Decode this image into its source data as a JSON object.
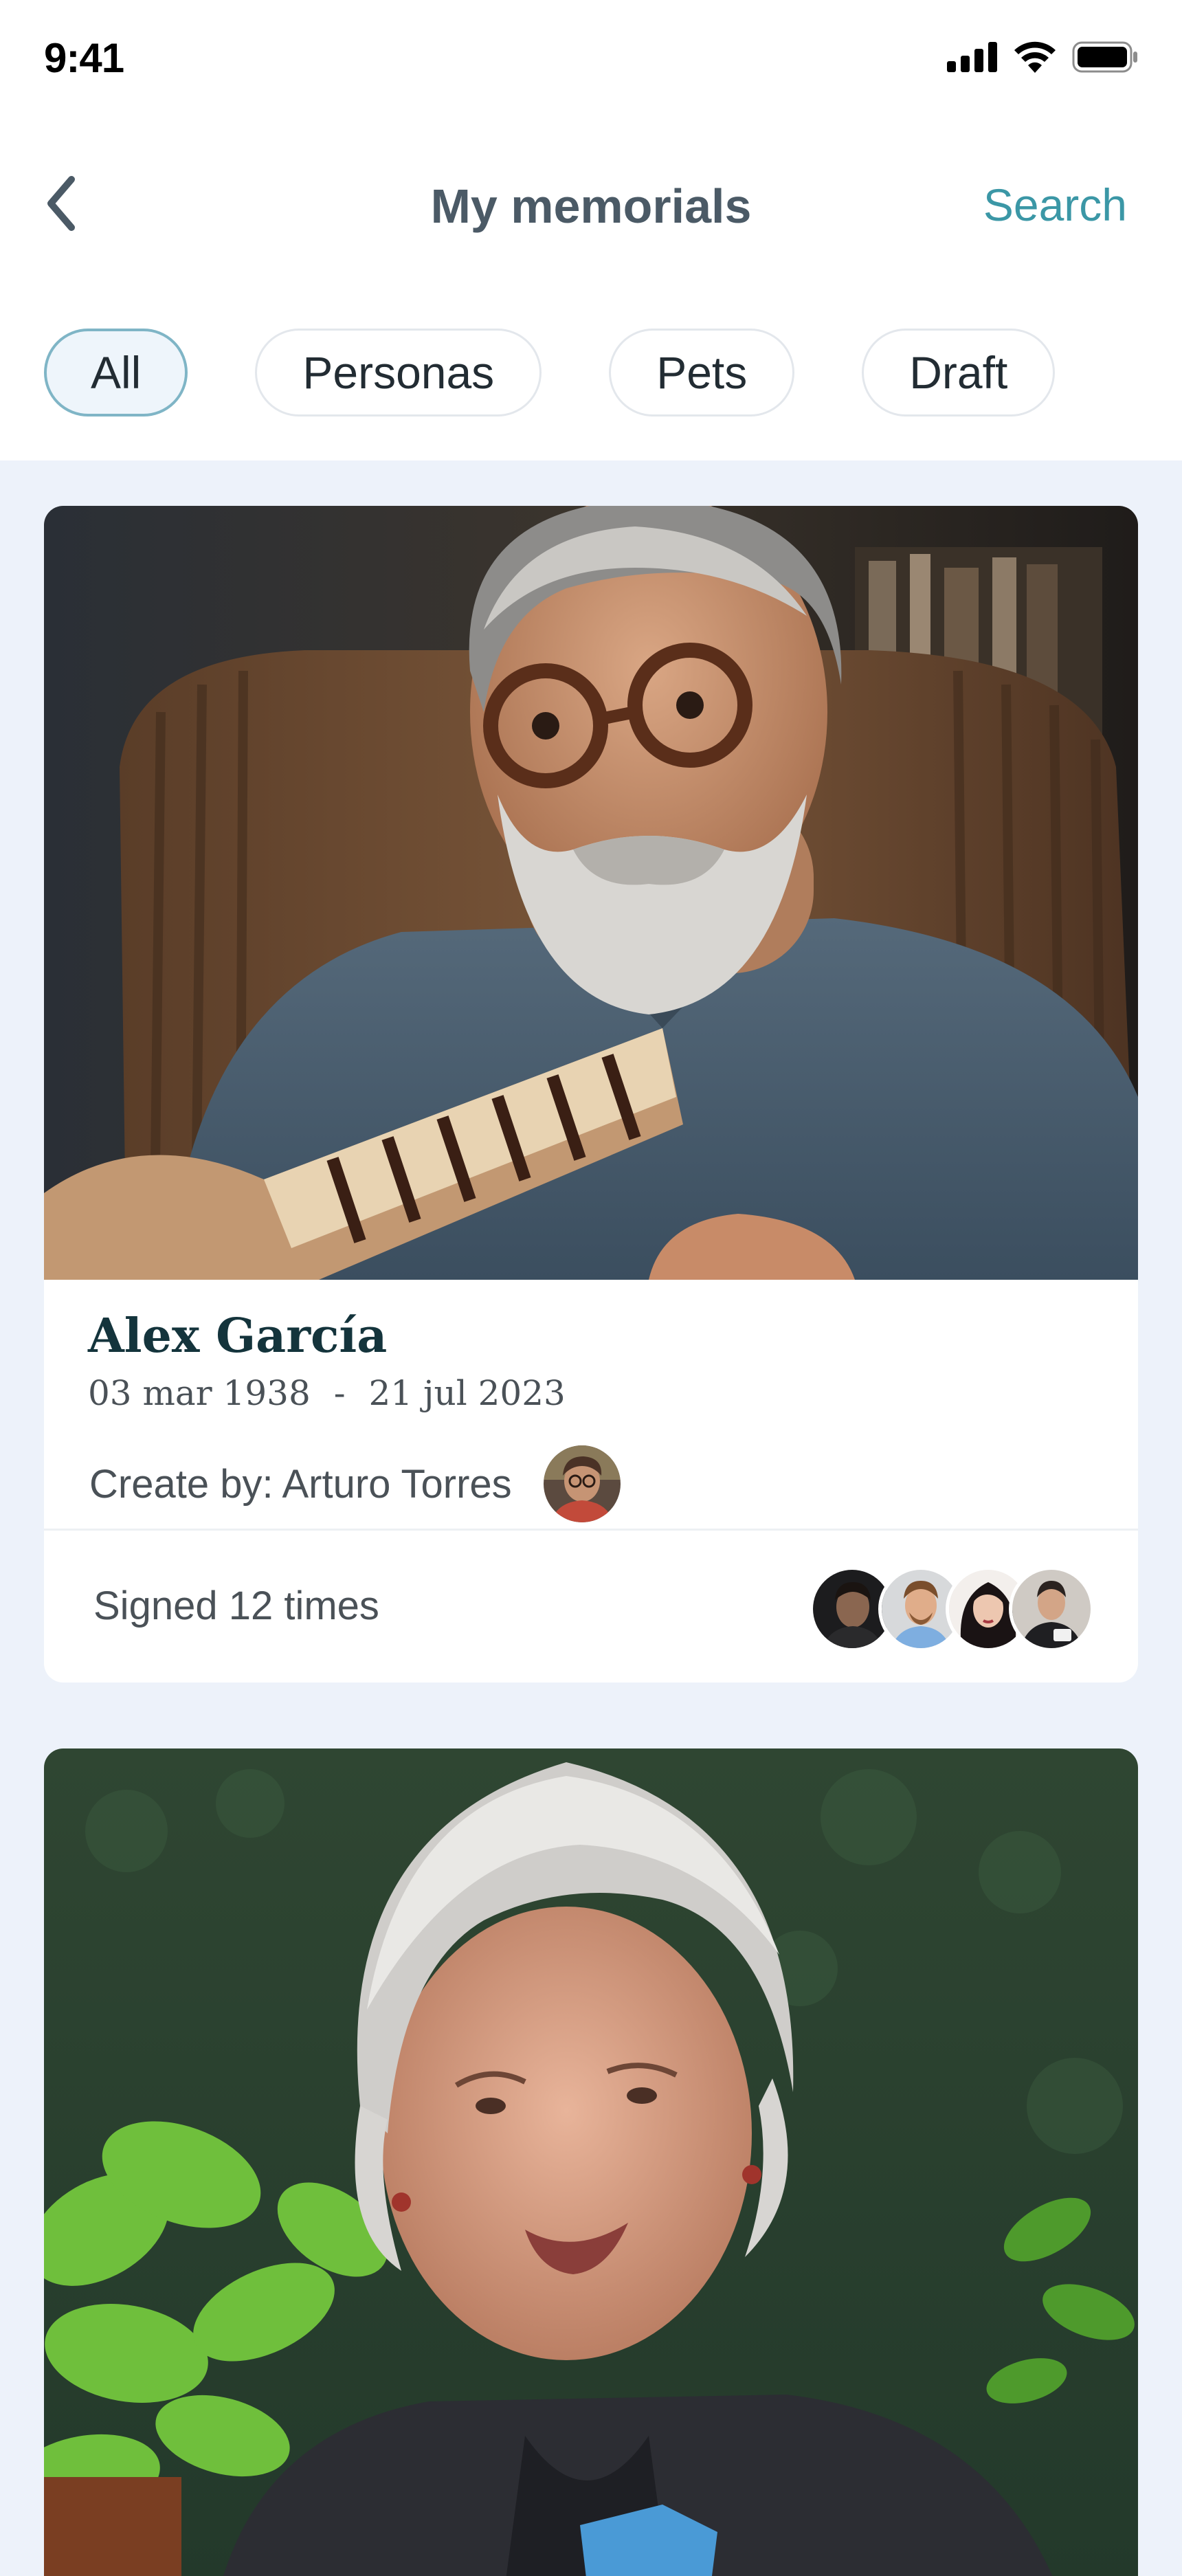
{
  "status_bar": {
    "time": "9:41"
  },
  "nav": {
    "title": "My memorials",
    "search_label": "Search"
  },
  "filters": [
    {
      "label": "All",
      "active": true
    },
    {
      "label": "Personas",
      "active": false
    },
    {
      "label": "Pets",
      "active": false
    },
    {
      "label": "Draft",
      "active": false
    }
  ],
  "memorials": [
    {
      "name": "Alex García",
      "birth": "03 mar 1938",
      "separator": "-",
      "death": "21 jul 2023",
      "created_by": "Create by: Arturo Torres",
      "signed": "Signed 12 times"
    },
    {
      "name": "",
      "birth": "",
      "death": ""
    }
  ],
  "colors": {
    "accent": "#3b97a6",
    "title": "#4b5a66",
    "name": "#14343c",
    "background": "#edf2fa",
    "chip_active_border": "#7fb5c6"
  }
}
